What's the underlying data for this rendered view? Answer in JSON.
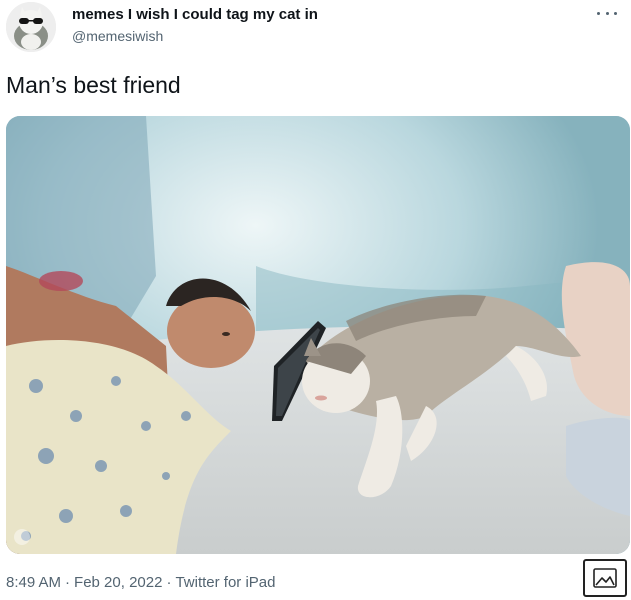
{
  "author": {
    "display_name": "memes I wish I could tag my cat in",
    "handle": "@memesiwish"
  },
  "tweet": {
    "text": "Man’s best friend"
  },
  "meta": {
    "time": "8:49 AM",
    "date": "Feb 20, 2022",
    "source": "Twitter for iPad",
    "separator": "·"
  },
  "icons": {
    "more": "more-icon",
    "image": "image-icon"
  },
  "colors": {
    "text_primary": "#0f1419",
    "text_secondary": "#536471"
  }
}
